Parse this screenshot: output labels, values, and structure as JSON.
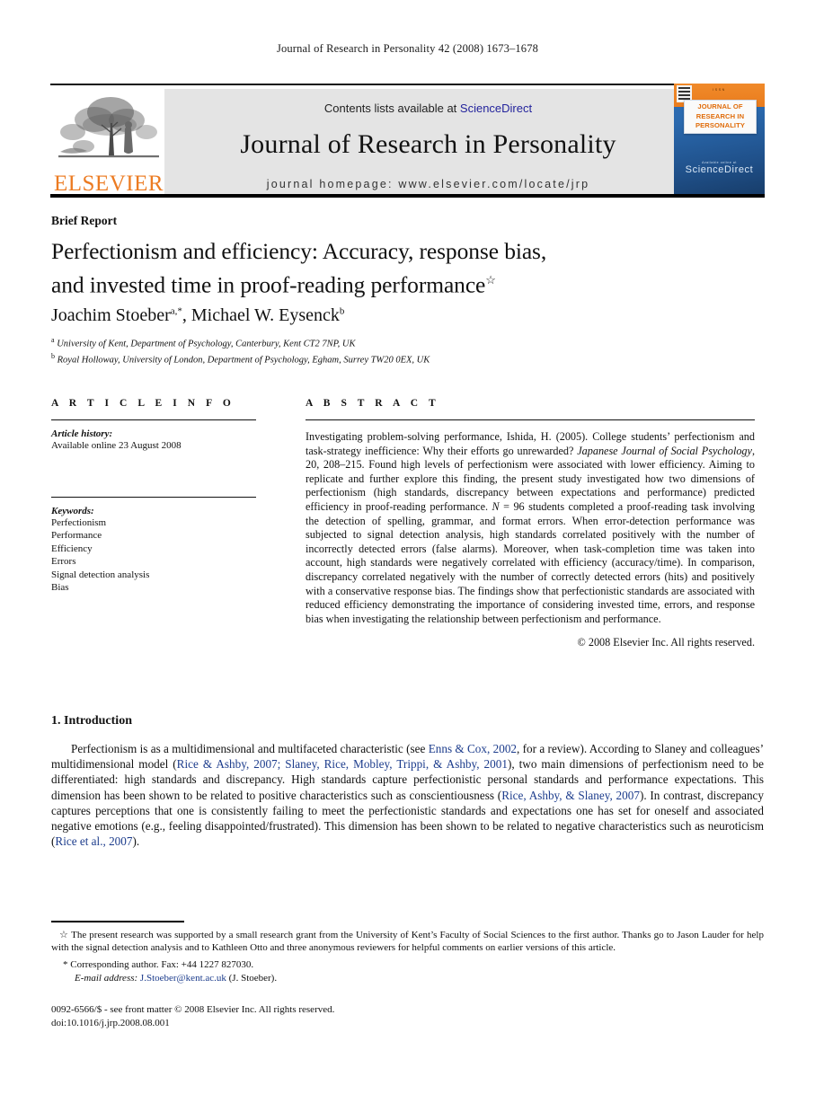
{
  "running_head": "Journal of Research in Personality 42 (2008) 1673–1678",
  "masthead": {
    "contents_prefix": "Contents lists available at ",
    "sciencedirect": "ScienceDirect",
    "journal_title": "Journal of Research in Personality",
    "homepage": "journal homepage: www.elsevier.com/locate/jrp",
    "publisher_wordmark": "ELSEVIER",
    "link_color": "#23239c",
    "banner_bg": "#e4e4e4"
  },
  "cover": {
    "issn_line": "ISSN",
    "title_line1": "JOURNAL OF",
    "title_line2": "RESEARCH IN",
    "title_line3": "PERSONALITY",
    "seal_top": "Available online at",
    "seal_mark": "ScienceDirect",
    "accent_color": "#ea7c1d"
  },
  "article": {
    "type_label": "Brief Report",
    "title_line1": "Perfectionism and efficiency: Accuracy, response bias,",
    "title_line2": "and invested time in proof-reading performance",
    "title_footnote_mark": "☆",
    "authors": "Joachim Stoeber",
    "author1_marks": "a,*",
    "authors_second": ", Michael W. Eysenck",
    "author2_marks": "b",
    "affiliation_a_mark": "a",
    "affiliation_a": "University of Kent, Department of Psychology, Canterbury, Kent CT2 7NP, UK",
    "affiliation_b_mark": "b",
    "affiliation_b": "Royal Holloway, University of London, Department of Psychology, Egham, Surrey TW20 0EX, UK"
  },
  "info": {
    "heading": "A R T I C L E    I N F O",
    "history_label": "Article history:",
    "history_value": "Available online 23 August 2008",
    "keywords_label": "Keywords:",
    "keywords": [
      "Perfectionism",
      "Performance",
      "Efficiency",
      "Errors",
      "Signal detection analysis",
      "Bias"
    ]
  },
  "abstract": {
    "heading": "A B S T R A C T",
    "part1": "Investigating problem-solving performance, Ishida, H. (2005). College students’ perfectionism and task-strategy inefficience: Why their efforts go unrewarded? ",
    "italic1": "Japanese Journal of Social Psychology",
    "part2": ", 20, 208–215. Found high levels of perfectionism were associated with lower efficiency. Aiming to replicate and further explore this finding, the present study investigated how two dimensions of perfectionism (high standards, discrepancy between expectations and performance) predicted efficiency in proof-reading performance. ",
    "italic2": "N",
    "part3": " = 96 students completed a proof-reading task involving the detection of spelling, grammar, and format errors. When error-detection performance was subjected to signal detection analysis, high standards correlated positively with the number of incorrectly detected errors (false alarms). Moreover, when task-completion time was taken into account, high standards were negatively correlated with efficiency (accuracy/time). In comparison, discrepancy correlated negatively with the number of correctly detected errors (hits) and positively with a conservative response bias. The findings show that perfectionistic standards are associated with reduced efficiency demonstrating the importance of considering invested time, errors, and response bias when investigating the relationship between perfectionism and performance.",
    "copyright": "© 2008 Elsevier Inc. All rights reserved."
  },
  "intro": {
    "heading": "1.  Introduction",
    "t1": "Perfectionism is as a multidimensional and multifaceted characteristic (see ",
    "c1": "Enns & Cox, 2002",
    "t2": ", for a review). According to Slaney and colleagues’ multidimensional model (",
    "c2": "Rice & Ashby, 2007; Slaney, Rice, Mobley, Trippi, & Ashby, 2001",
    "t3": "), two main dimensions of perfectionism need to be differentiated: high standards and discrepancy. High standards capture perfectionistic personal standards and performance expectations. This dimension has been shown to be related to positive characteristics such as conscientiousness (",
    "c3": "Rice, Ashby, & Slaney, 2007",
    "t4": "). In contrast, discrepancy captures perceptions that one is consistently failing to meet the perfectionistic standards and expectations one has set for oneself and associated negative emotions (e.g., feeling disappointed/frustrated). This dimension has been shown to be related to negative characteristics such as neuroticism (",
    "c4": "Rice et al., 2007",
    "t5": ")."
  },
  "footnotes": {
    "star_mark": "☆",
    "star_text": "  The present research was supported by a small research grant from the University of Kent’s Faculty of Social Sciences to the first author. Thanks go to Jason Lauder for help with the signal detection analysis and to Kathleen Otto and three anonymous reviewers for helpful comments on earlier versions of this article.",
    "corr_mark": "*",
    "corr_text": " Corresponding author. Fax: +44 1227 827030.",
    "email_label": "E-mail address:",
    "email": "J.Stoeber@kent.ac.uk",
    "email_suffix": " (J. Stoeber)."
  },
  "imprint": {
    "line1": "0092-6566/$ - see front matter © 2008 Elsevier Inc. All rights reserved.",
    "line2": "doi:10.1016/j.jrp.2008.08.001"
  }
}
